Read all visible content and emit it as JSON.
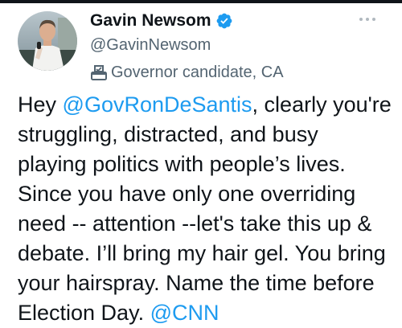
{
  "author": {
    "name": "Gavin Newsom",
    "handle": "@GavinNewsom",
    "label": "Governor candidate, CA",
    "verified": true,
    "icons": {
      "verified": "verified-badge-icon",
      "label": "ballot-box-icon",
      "more": "more-horizontal-icon"
    }
  },
  "tweet": {
    "lines": [
      {
        "pre": "Hey ",
        "mention": "@GovRonDeSantis",
        "post": ", clearly you're"
      },
      {
        "pre": "struggling, distracted, and busy",
        "mention": "",
        "post": ""
      },
      {
        "pre": "playing politics with people’s lives.",
        "mention": "",
        "post": ""
      },
      {
        "pre": "Since you have only one overriding",
        "mention": "",
        "post": ""
      },
      {
        "pre": "need -- attention --let's take this up &",
        "mention": "",
        "post": ""
      },
      {
        "pre": "debate. I’ll bring my hair gel. You bring",
        "mention": "",
        "post": ""
      },
      {
        "pre": "your hairspray. Name the time before",
        "mention": "",
        "post": ""
      },
      {
        "pre": "Election Day. ",
        "mention": "@CNN",
        "post": ""
      }
    ]
  },
  "colors": {
    "text": "#0f1419",
    "secondary": "#536471",
    "link": "#1d9bf0",
    "verified": "#1d9bf0"
  }
}
